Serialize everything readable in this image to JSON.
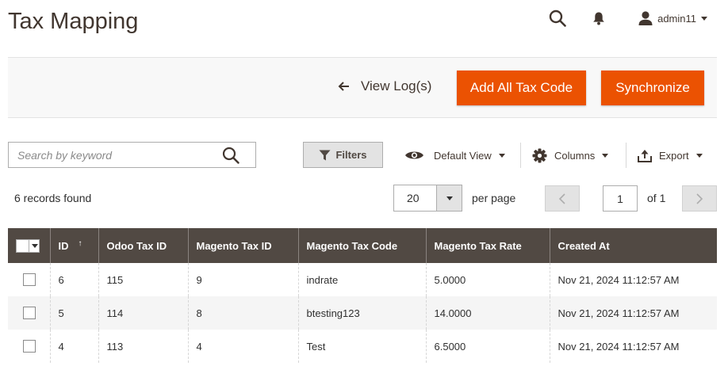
{
  "page": {
    "title": "Tax Mapping"
  },
  "header": {
    "user_name": "admin11",
    "search_icon": "search-icon",
    "notifications_icon": "bell-icon",
    "user_icon": "user-icon"
  },
  "actions": {
    "view_log": "View Log(s)",
    "add_all": "Add All Tax Code",
    "synchronize": "Synchronize"
  },
  "toolbar": {
    "search_placeholder": "Search by keyword",
    "filters": "Filters",
    "default_view": "Default View",
    "columns": "Columns",
    "export": "Export"
  },
  "summary": {
    "records_found": "6 records found"
  },
  "pager": {
    "per_page_value": "20",
    "per_page_label": "per page",
    "current_page": "1",
    "of_pages": "of 1"
  },
  "grid": {
    "columns": [
      "ID",
      "Odoo Tax ID",
      "Magento Tax ID",
      "Magento Tax Code",
      "Magento Tax Rate",
      "Created At"
    ],
    "sort_indicator": "↑",
    "rows": [
      [
        "6",
        "115",
        "9",
        "indrate",
        "5.0000",
        "Nov 21, 2024 11:12:57 AM"
      ],
      [
        "5",
        "114",
        "8",
        "btesting123",
        "14.0000",
        "Nov 21, 2024 11:12:57 AM"
      ],
      [
        "4",
        "113",
        "4",
        "Test",
        "6.5000",
        "Nov 21, 2024 11:12:57 AM"
      ]
    ]
  },
  "colors": {
    "accent": "#eb5202",
    "grid_header": "#514943",
    "title": "#41362f"
  }
}
